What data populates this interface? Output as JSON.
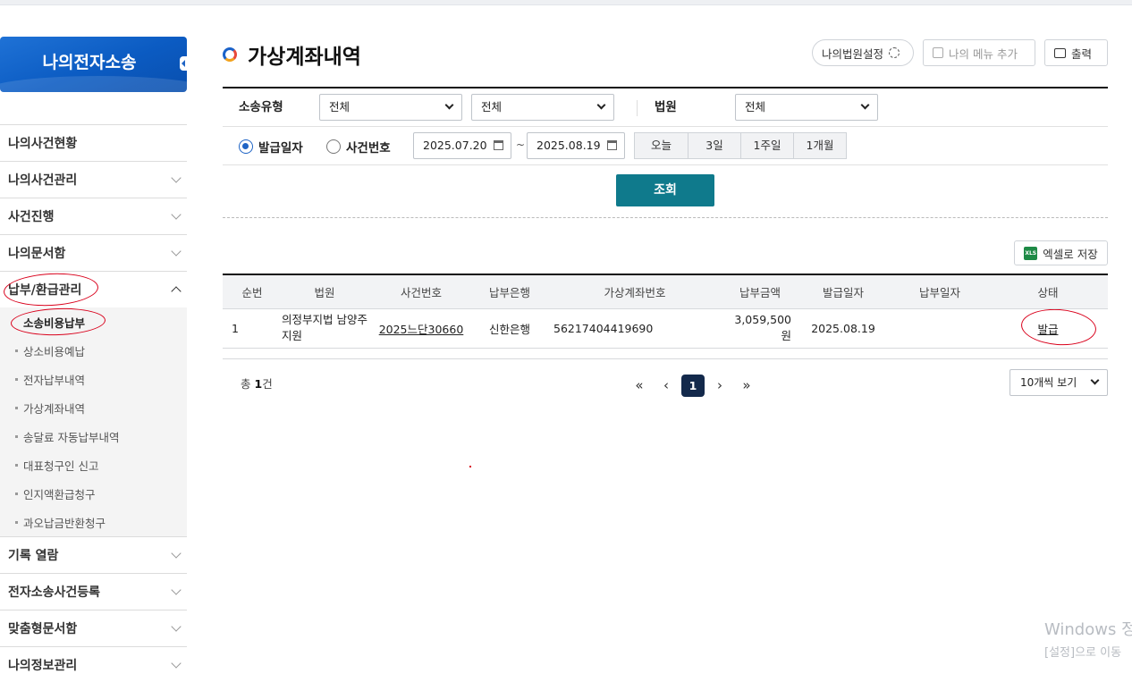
{
  "sidebar": {
    "title": "나의전자소송",
    "items": [
      {
        "label": "나의사건현황"
      },
      {
        "label": "나의사건관리"
      },
      {
        "label": "사건진행"
      },
      {
        "label": "나의문서함"
      },
      {
        "label": "납부/환급관리"
      },
      {
        "label": "기록 열람"
      },
      {
        "label": "전자소송사건등록"
      },
      {
        "label": "맞춤형문서함"
      },
      {
        "label": "나의정보관리"
      }
    ],
    "submenu": [
      {
        "label": "소송비용납부"
      },
      {
        "label": "상소비용예납"
      },
      {
        "label": "전자납부내역"
      },
      {
        "label": "가상계좌내역"
      },
      {
        "label": "송달료 자동납부내역"
      },
      {
        "label": "대표청구인 신고"
      },
      {
        "label": "인지액환급청구"
      },
      {
        "label": "과오납금반환청구"
      }
    ]
  },
  "header": {
    "title": "가상계좌내역",
    "court_settings_label": "나의법원설정",
    "add_menu_label": "나의 메뉴 추가",
    "print_label": "출력"
  },
  "search": {
    "type_label": "소송유형",
    "type_value_1": "전체",
    "type_value_2": "전체",
    "court_label": "법원",
    "court_value": "전체",
    "radio_issue_date": "발급일자",
    "radio_case_no": "사건번호",
    "date_from": "2025.07.20",
    "date_sep": "~",
    "date_to": "2025.08.19",
    "periods": [
      "오늘",
      "3일",
      "1주일",
      "1개월"
    ],
    "search_button": "조회"
  },
  "excel_button": "엑셀로 저장",
  "table": {
    "columns": [
      "순번",
      "법원",
      "사건번호",
      "납부은행",
      "가상계좌번호",
      "납부금액",
      "발급일자",
      "납부일자",
      "상태"
    ],
    "rows": [
      {
        "no": "1",
        "court": "의정부지법 남양주지원",
        "case_no": "2025느단30660",
        "bank": "신한은행",
        "account": "56217404419690",
        "amount": "3,059,500 원",
        "issue_date": "2025.08.19",
        "pay_date": "",
        "status": "발급"
      }
    ]
  },
  "footer": {
    "total_prefix": "총 ",
    "total_count": "1",
    "total_suffix": "건",
    "pager": {
      "first": "«",
      "prev": "‹",
      "current": "1",
      "next": "›",
      "last": "»"
    },
    "page_size": "10개씩 보기"
  },
  "watermark": {
    "line1": "Windows 정",
    "line2": "[설정]으로 이동"
  },
  "colors": {
    "brand_blue": "#1f64c5",
    "search_button": "#0f7a8c",
    "pager_current": "#13294b",
    "annotation_red": "#d9001b"
  }
}
